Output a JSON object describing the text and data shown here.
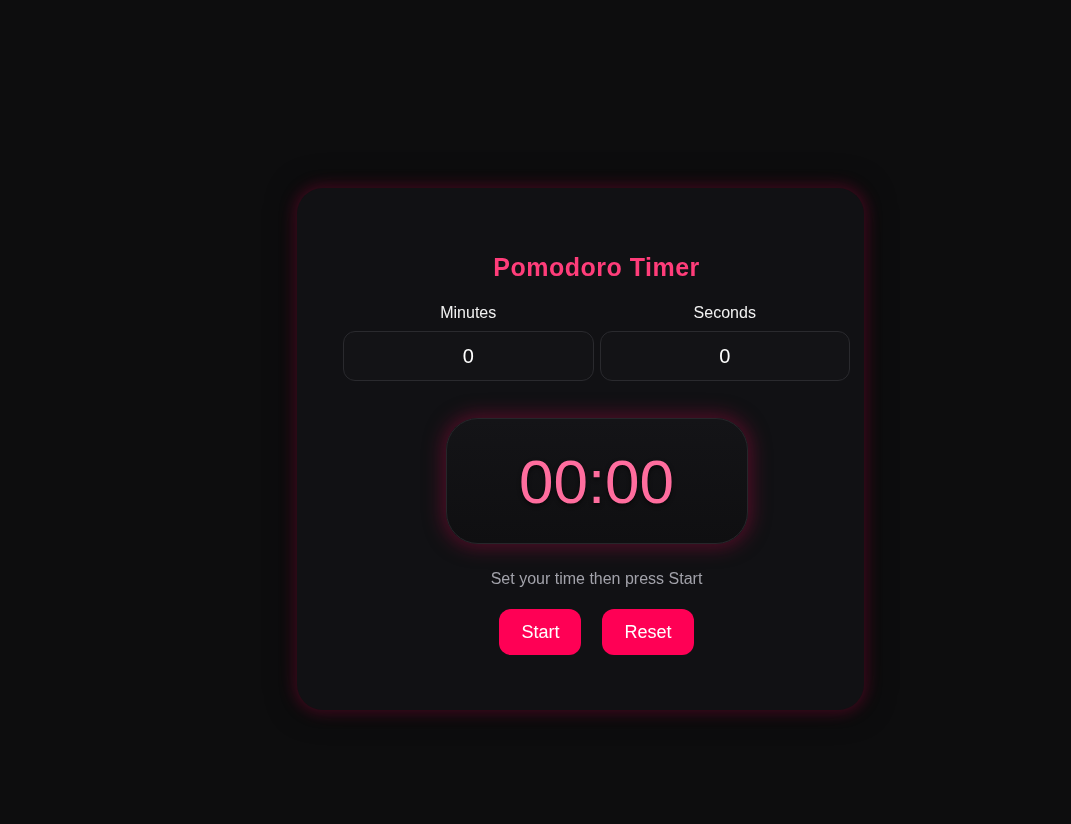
{
  "title": "Pomodoro Timer",
  "fields": [
    {
      "label": "Minutes",
      "value": "0"
    },
    {
      "label": "Seconds",
      "value": "0"
    }
  ],
  "display": "00:00",
  "hint": "Set your time then press Start",
  "buttons": [
    "Start",
    "Reset"
  ]
}
